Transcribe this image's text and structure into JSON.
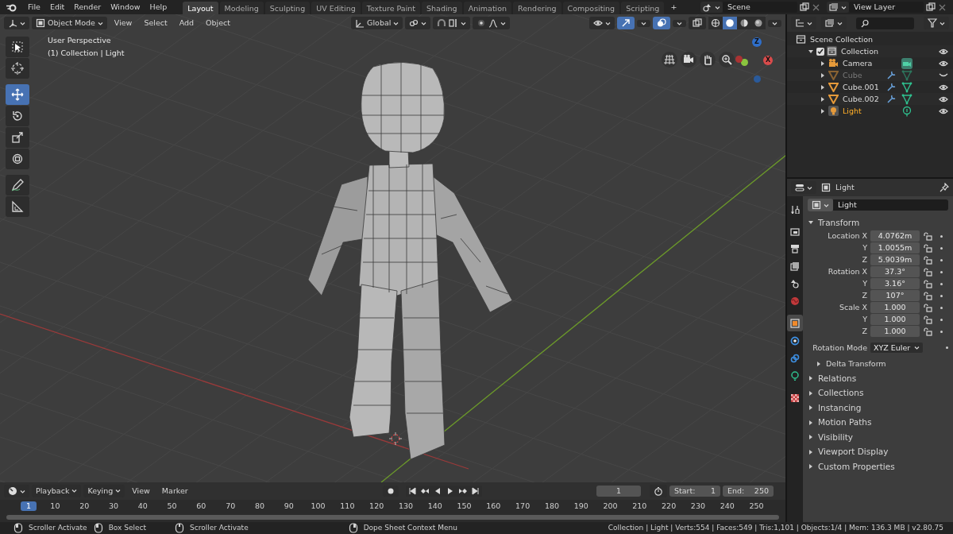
{
  "menu": [
    "File",
    "Edit",
    "Render",
    "Window",
    "Help"
  ],
  "workspaces": [
    {
      "label": "Layout",
      "selected": true
    },
    {
      "label": "Modeling",
      "selected": false
    },
    {
      "label": "Sculpting",
      "selected": false
    },
    {
      "label": "UV Editing",
      "selected": false
    },
    {
      "label": "Texture Paint",
      "selected": false
    },
    {
      "label": "Shading",
      "selected": false
    },
    {
      "label": "Animation",
      "selected": false
    },
    {
      "label": "Rendering",
      "selected": false
    },
    {
      "label": "Compositing",
      "selected": false
    },
    {
      "label": "Scripting",
      "selected": false
    }
  ],
  "add_workspace": "+",
  "scene": "Scene",
  "view_layer": "View Layer",
  "viewport": {
    "mode": "Object Mode",
    "menus": [
      "View",
      "Select",
      "Add",
      "Object"
    ],
    "orientation": "Global",
    "shading": [
      {
        "kind": "wireframe",
        "selected": false
      },
      {
        "kind": "solid",
        "selected": true
      },
      {
        "kind": "material",
        "selected": false
      },
      {
        "kind": "rendered",
        "selected": false
      }
    ],
    "overlay_text": [
      "User Perspective",
      "(1) Collection | Light"
    ],
    "tools": [
      {
        "kind": "select",
        "selected": false
      },
      {
        "kind": "cursor",
        "selected": false
      },
      {
        "kind": "move",
        "selected": true
      },
      {
        "kind": "rotate",
        "selected": false
      },
      {
        "kind": "scale",
        "selected": false
      },
      {
        "kind": "transform",
        "selected": false
      },
      {
        "kind": "annotate",
        "selected": false
      },
      {
        "kind": "measure",
        "selected": false
      }
    ],
    "gizmo_labels": [
      "Z",
      "X"
    ]
  },
  "outliner": {
    "tree": [
      {
        "label": "Scene Collection",
        "kind": "scene_collection",
        "children": [
          {
            "label": "Collection",
            "kind": "collection",
            "checked": true,
            "expanded": true,
            "children": [
              {
                "label": "Camera",
                "kind": "camera",
                "expanded": false,
                "hidden": false,
                "active": false,
                "modifier": false
              },
              {
                "label": "Cube",
                "kind": "mesh",
                "expanded": false,
                "hidden": true,
                "active": false,
                "modifier": true
              },
              {
                "label": "Cube.001",
                "kind": "mesh",
                "expanded": false,
                "hidden": false,
                "active": false,
                "modifier": true
              },
              {
                "label": "Cube.002",
                "kind": "mesh",
                "expanded": false,
                "hidden": false,
                "active": false,
                "modifier": true
              },
              {
                "label": "Light",
                "kind": "light",
                "expanded": false,
                "hidden": false,
                "active": true,
                "modifier": false
              }
            ]
          }
        ]
      }
    ]
  },
  "properties": {
    "title": "Light",
    "object_name": "Light",
    "tabs": [
      {
        "kind": "tool",
        "selected": false
      },
      {
        "kind": "render",
        "selected": false
      },
      {
        "kind": "output",
        "selected": false
      },
      {
        "kind": "view_layer",
        "selected": false
      },
      {
        "kind": "scene",
        "selected": false
      },
      {
        "kind": "world",
        "selected": false
      },
      {
        "kind": "object",
        "selected": true
      },
      {
        "kind": "physics",
        "selected": false
      },
      {
        "kind": "constraints",
        "selected": false
      },
      {
        "kind": "light_data",
        "selected": false
      },
      {
        "kind": "texture",
        "selected": false
      }
    ],
    "panels": [
      {
        "title": "Transform",
        "expanded": true,
        "rows": [
          {
            "label": "Location X",
            "value": "4.0762m"
          },
          {
            "label": "Y",
            "value": "1.0055m"
          },
          {
            "label": "Z",
            "value": "5.9039m"
          },
          {
            "label": "Rotation X",
            "value": "37.3°"
          },
          {
            "label": "Y",
            "value": "3.16°"
          },
          {
            "label": "Z",
            "value": "107°"
          },
          {
            "label": "Scale X",
            "value": "1.000"
          },
          {
            "label": "Y",
            "value": "1.000"
          },
          {
            "label": "Z",
            "value": "1.000"
          }
        ],
        "rotation_mode": {
          "label": "Rotation Mode",
          "value": "XYZ Euler"
        },
        "subpanels": [
          {
            "title": "Delta Transform",
            "expanded": false
          }
        ]
      },
      {
        "title": "Relations",
        "expanded": false
      },
      {
        "title": "Collections",
        "expanded": false
      },
      {
        "title": "Instancing",
        "expanded": false
      },
      {
        "title": "Motion Paths",
        "expanded": false
      },
      {
        "title": "Visibility",
        "expanded": false
      },
      {
        "title": "Viewport Display",
        "expanded": false
      },
      {
        "title": "Custom Properties",
        "expanded": false
      }
    ]
  },
  "timeline": {
    "menus": [
      {
        "label": "Playback",
        "dropdown": true
      },
      {
        "label": "Keying",
        "dropdown": true
      },
      {
        "label": "View",
        "dropdown": false
      },
      {
        "label": "Marker",
        "dropdown": false
      }
    ],
    "current_frame": "1",
    "start": {
      "label": "Start:",
      "value": "1"
    },
    "end": {
      "label": "End:",
      "value": "250"
    },
    "playhead": "1",
    "ticks": [
      "10",
      "20",
      "30",
      "40",
      "50",
      "60",
      "70",
      "80",
      "90",
      "100",
      "110",
      "120",
      "130",
      "140",
      "150",
      "160",
      "170",
      "180",
      "190",
      "200",
      "210",
      "220",
      "230",
      "240",
      "250"
    ]
  },
  "status_bar": {
    "hints": [
      {
        "kind": "left",
        "text": "Scroller Activate"
      },
      {
        "kind": "drag",
        "text": "Box Select"
      },
      {
        "kind": "middle",
        "text": "Scroller Activate"
      },
      {
        "kind": "right",
        "text": "Dope Sheet Context Menu"
      }
    ],
    "stats": "Collection | Light | Verts:554 | Faces:549 | Tris:1,101 | Objects:1/4 | Mem: 136.3 MB | v2.80.75"
  }
}
